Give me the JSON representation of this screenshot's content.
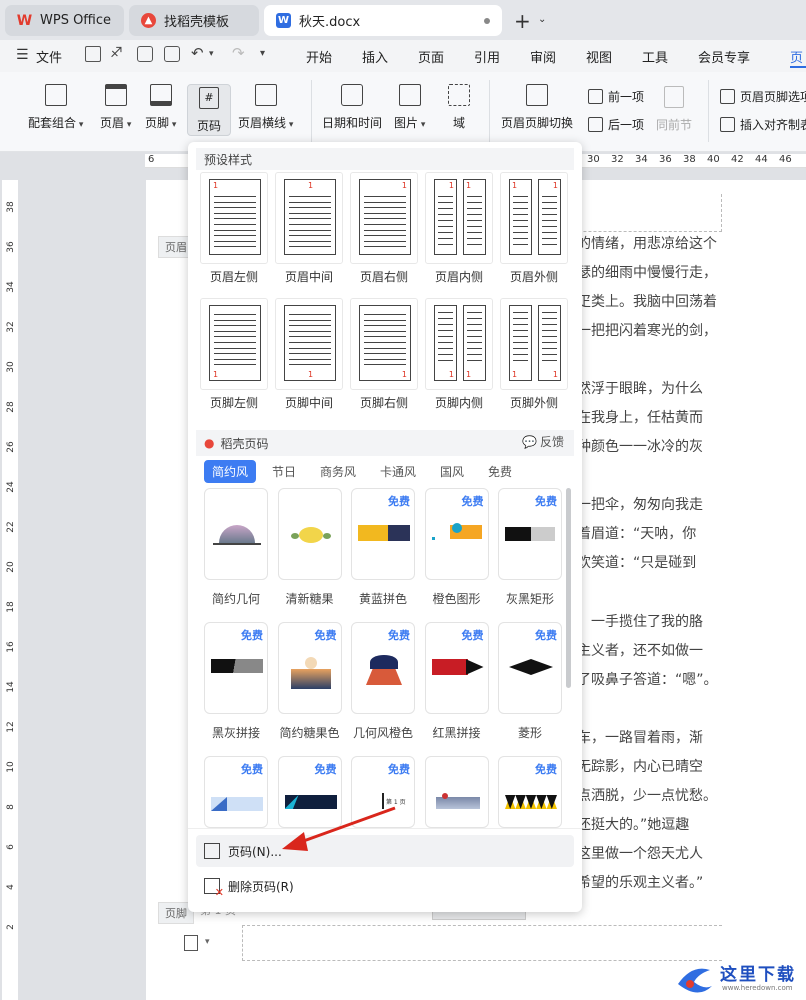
{
  "tabs": [
    {
      "label": "WPS Office",
      "icon": "wps-logo-icon"
    },
    {
      "label": "找稻壳模板",
      "icon": "daoke-icon"
    },
    {
      "label": "秋天.docx",
      "icon": "word-doc-icon"
    }
  ],
  "menu": {
    "file": "文件",
    "items": [
      "开始",
      "插入",
      "页面",
      "引用",
      "审阅",
      "视图",
      "工具",
      "会员专享",
      "页"
    ]
  },
  "ribbon": {
    "buttons": [
      "配套组合",
      "页眉",
      "页脚",
      "页码",
      "页眉横线",
      "日期和时间",
      "图片",
      "域",
      "页眉页脚切换"
    ],
    "nav": {
      "prev": "前一项",
      "next": "后一项",
      "same": "同前节"
    },
    "right": {
      "options": "页眉页脚选项",
      "insert": "插入对齐制表"
    }
  },
  "ruler": [
    "6",
    "30",
    "32",
    "34",
    "36",
    "38",
    "40",
    "42",
    "44",
    "46"
  ],
  "vruler": [
    "38",
    "36",
    "34",
    "32",
    "30",
    "28",
    "26",
    "24",
    "22",
    "20",
    "18",
    "16",
    "14",
    "12",
    "10",
    "8",
    "6",
    "4",
    "2"
  ],
  "doc_lines": [
    "的情绪，用悲凉给这个",
    "瑟的细雨中慢慢行走，",
    "疋类上。我脑中回荡着",
    "一把把闪着寒光的剑，",
    "然浮于眼眸，为什么",
    "在我身上，任枯黄而",
    "种颜色一一冰冷的灰",
    "一把伞，匆匆向我走",
    "着眉道：“天呐，你",
    "欢笑道：“只是碰到",
    "，一手揽住了我的胳",
    "主义者，还不如做一",
    "了吸鼻子答道：“嗯”。",
    "车，一路冒着雨，渐",
    "无踪影，内心已晴空",
    "点洒脱，少一点忧愁。",
    "还挺大的。”她逗趣",
    "这里做一个怨天尤人",
    "希望的乐观主义者。”"
  ],
  "page_labels": {
    "header": "页眉",
    "footer": "页脚",
    "footer_page": "第 1 页"
  },
  "dropdown": {
    "preset_title": "预设样式",
    "header_presets": [
      "页眉左侧",
      "页眉中间",
      "页眉右侧",
      "页眉内侧",
      "页眉外侧"
    ],
    "footer_presets": [
      "页脚左侧",
      "页脚中间",
      "页脚右侧",
      "页脚内侧",
      "页脚外侧"
    ],
    "daoke_title": "稻壳页码",
    "feedback": "反馈",
    "categories": [
      "简约风",
      "节日",
      "商务风",
      "卡通风",
      "国风",
      "免费"
    ],
    "free_badge": "免费",
    "cards_row1": [
      "简约几何",
      "清新糖果",
      "黄蓝拼色",
      "橙色图形",
      "灰黑矩形"
    ],
    "cards_row2": [
      "黑灰拼接",
      "简约糖果色",
      "几何风橙色",
      "红黑拼接",
      "菱形"
    ],
    "menu_items": [
      "页码(N)...",
      "删除页码(R)"
    ]
  },
  "watermark": {
    "title": "这里下载",
    "url": "www.heredown.com"
  },
  "colors": {
    "accent": "#3d7cf2",
    "wps_red": "#e23b2e",
    "arrow": "#d9261c"
  }
}
